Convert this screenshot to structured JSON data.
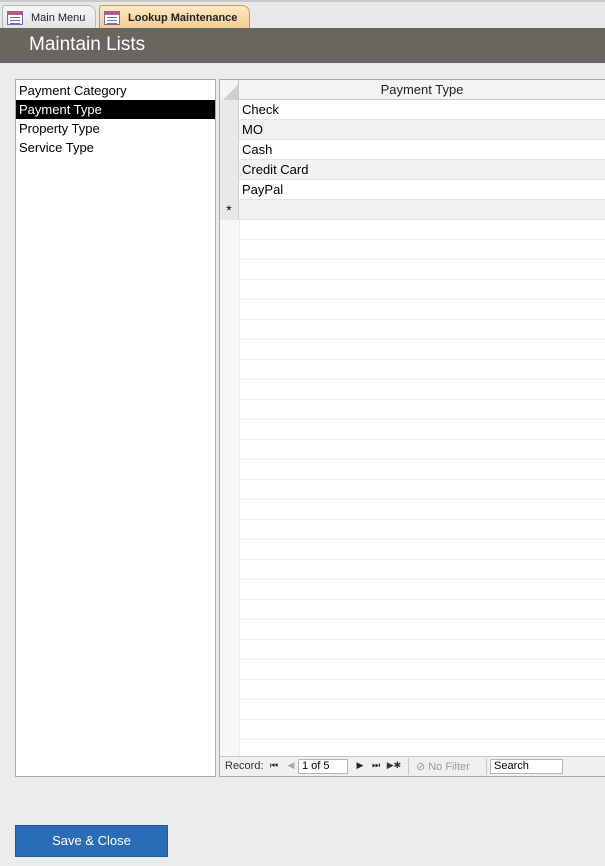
{
  "tabs": [
    {
      "label": "Main Menu",
      "active": false
    },
    {
      "label": "Lookup Maintenance",
      "active": true
    }
  ],
  "header": {
    "title": "Maintain Lists"
  },
  "lists": {
    "items": [
      "Payment Category",
      "Payment Type",
      "Property Type",
      "Service Type"
    ],
    "selected": "Payment Type"
  },
  "datasheet": {
    "column_header": "Payment Type",
    "rows": [
      "Check",
      "MO",
      "Cash",
      "Credit Card",
      "PayPal"
    ],
    "new_record_marker": "*"
  },
  "navigation": {
    "record_label": "Record:",
    "first_symbol": "⏮",
    "prev_symbol": "◀",
    "position": "1 of 5",
    "next_symbol": "▶",
    "last_symbol": "⏭",
    "new_symbol": "▶✱",
    "filter_icon": "⊘",
    "filter_label": "No Filter",
    "search_label": "Search"
  },
  "buttons": {
    "save_close": "Save & Close"
  },
  "colors": {
    "header_bg": "#69655f",
    "button_bg": "#2a6cb5",
    "active_tab": "#f5c98a"
  }
}
